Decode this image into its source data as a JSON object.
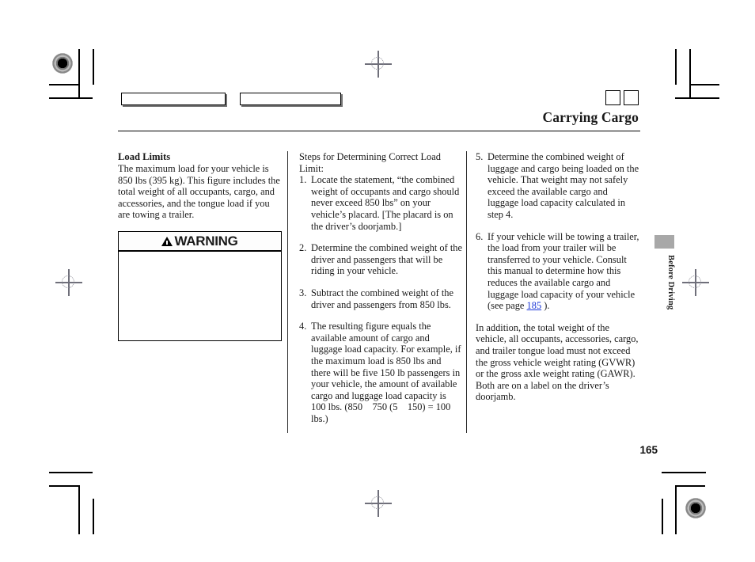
{
  "header": {
    "title": "Carrying Cargo",
    "icon_squares": [
      "square-icon-1",
      "square-icon-2"
    ]
  },
  "columns": {
    "left": {
      "section_title": "Load Limits",
      "paragraph": "The maximum load for your vehicle is 850 lbs (395 kg). This figure includes the total weight of all occupants, cargo, and accessories, and the tongue load if you are towing a trailer.",
      "warning": {
        "icon": "warning-triangle-icon",
        "label": "WARNING",
        "body": ""
      }
    },
    "middle": {
      "intro": "Steps for Determining Correct Load Limit:",
      "steps": [
        {
          "num": "1.",
          "text": "Locate the statement, “the combined weight of occupants and cargo should never exceed 850 lbs” on your vehicle’s placard. [The placard is on the driver’s doorjamb.]"
        },
        {
          "num": "2.",
          "text": "Determine the combined weight of the driver and passengers that will be riding in your vehicle."
        },
        {
          "num": "3.",
          "text": "Subtract the combined weight of the driver and passengers from 850 lbs."
        },
        {
          "num": "4.",
          "text": "The resulting figure equals the available amount of cargo and luggage load capacity. For example, if the maximum load is 850 lbs and there will be five 150 lb passengers in your vehicle, the amount of available cargo and luggage load capacity is 100 lbs. (850    750 (5    150) = 100 lbs.)"
        }
      ]
    },
    "right": {
      "steps": [
        {
          "num": "5.",
          "text": "Determine the combined weight of luggage and cargo being loaded on the vehicle. That weight may not safely exceed the available cargo and luggage load capacity calculated in step 4."
        },
        {
          "num": "6.",
          "text_before_link": "If your vehicle will be towing a trailer, the load from your trailer will be transferred to your vehicle. Consult this manual to determine how this reduces the available cargo and luggage load capacity of your vehicle (see page ",
          "link": "185",
          "text_after_link": " )."
        }
      ],
      "closing_paragraph": "In addition, the total weight of the vehicle, all occupants, accessories, cargo, and trailer tongue load must not exceed the gross vehicle weight rating (GVWR) or the gross axle weight rating (GAWR). Both are on a label on the driver’s doorjamb."
    }
  },
  "side_tab": {
    "label": "Before Driving",
    "tab_color": "#a8a8a8"
  },
  "footer": {
    "page_number": "165"
  },
  "print_marks": {
    "registration_bullseye": "registration-bullseye-mark",
    "crosshair": "registration-crosshair-mark",
    "color_bars": [
      "color-bar-1",
      "color-bar-2"
    ]
  },
  "colors": {
    "link": "#1a35d6",
    "text": "#1a1a1a",
    "tab_gray": "#a8a8a8"
  }
}
